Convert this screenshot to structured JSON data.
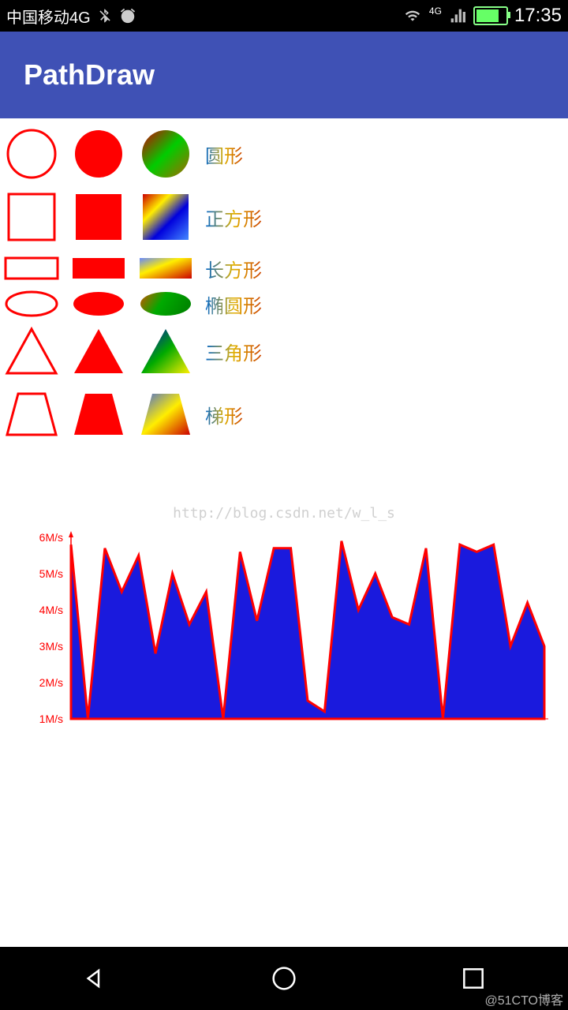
{
  "status_bar": {
    "carrier": "中国移动4G",
    "time": "17:35",
    "network_label": "4G"
  },
  "app": {
    "title": "PathDraw"
  },
  "shapes": [
    {
      "label": "圆形"
    },
    {
      "label": "正方形"
    },
    {
      "label": "长方形"
    },
    {
      "label": "椭圆形"
    },
    {
      "label": "三角形"
    },
    {
      "label": "梯形"
    }
  ],
  "watermark": "http://blog.csdn.net/w_l_s",
  "credit": "@51CTO博客",
  "chart_data": {
    "type": "area",
    "ylabel_unit": "M/s",
    "ylim": [
      1,
      6
    ],
    "y_ticks": [
      "6M/s",
      "5M/s",
      "4M/s",
      "3M/s",
      "2M/s",
      "1M/s"
    ],
    "values": [
      5.8,
      1.0,
      5.7,
      4.5,
      5.5,
      2.8,
      5.0,
      3.6,
      4.5,
      1.0,
      5.6,
      3.7,
      5.7,
      5.7,
      1.5,
      1.2,
      5.9,
      4.0,
      5.0,
      3.8,
      3.6,
      5.7,
      1.0,
      5.8,
      5.6,
      5.8,
      3.0,
      4.2,
      3.0
    ]
  }
}
